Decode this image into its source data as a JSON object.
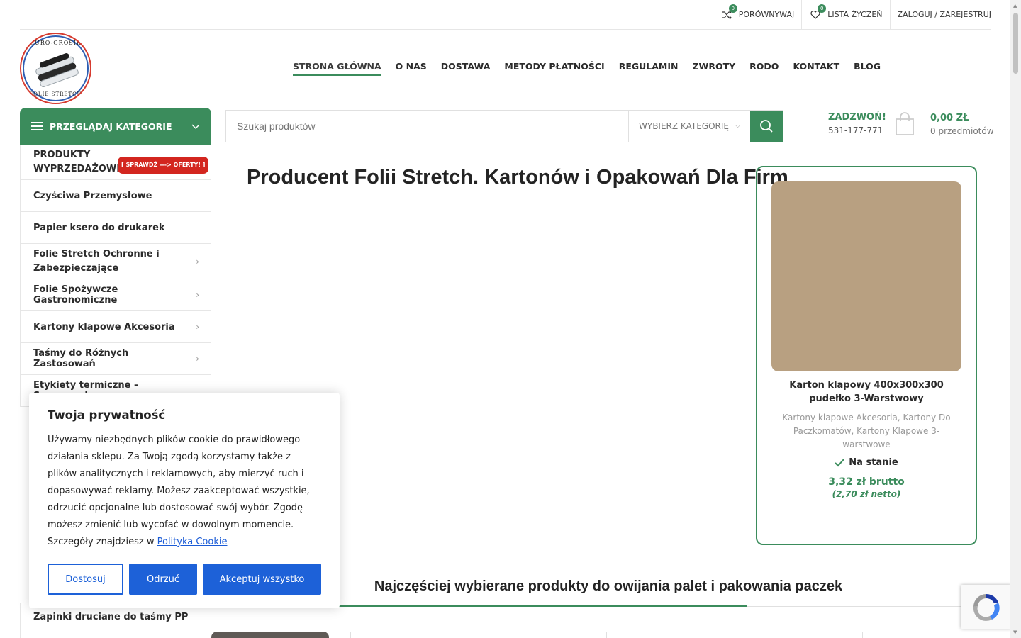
{
  "topbar": {
    "compare_label": "PORÓWNYWAJ",
    "compare_count": "0",
    "wishlist_label": "LISTA ŻYCZEŃ",
    "wishlist_count": "0",
    "login_label": "ZALOGUJ / ZAREJESTRUJ"
  },
  "logo": {
    "top_text": "EURO-GROSIK",
    "bottom_text": "FOLIE STRETCH"
  },
  "nav": {
    "items": [
      {
        "label": "STRONA GŁÓWNA"
      },
      {
        "label": "O NAS"
      },
      {
        "label": "DOSTAWA"
      },
      {
        "label": "METODY PŁATNOŚCI"
      },
      {
        "label": "REGULAMIN"
      },
      {
        "label": "ZWROTY"
      },
      {
        "label": "RODO"
      },
      {
        "label": "KONTAKT"
      },
      {
        "label": "BLOG"
      }
    ]
  },
  "categories": {
    "header": "PRZEGLĄDAJ KATEGORIE",
    "items": [
      {
        "label": "PRODUKTY WYPRZEDAŻOWE",
        "tag": "[ SPRAWDŹ ---> OFERTY! ]"
      },
      {
        "label": "Czyściwa Przemysłowe"
      },
      {
        "label": "Papier ksero do drukarek"
      },
      {
        "label": "Folie Stretch Ochronne i Zabezpieczające"
      },
      {
        "label": "Folie Spożywcze Gastronomiczne"
      },
      {
        "label": "Kartony klapowe Akcesoria"
      },
      {
        "label": "Taśmy do Różnych Zastosowań"
      },
      {
        "label": "Etykiety termiczne – Samoprzylepne"
      }
    ],
    "last_item": "Zapinki druciane do taśmy PP"
  },
  "search": {
    "placeholder": "Szukaj produktów",
    "category_select": "WYBIERZ KATEGORIĘ"
  },
  "contact": {
    "label": "ZADZWOŃ!",
    "phone": "531-177-771"
  },
  "cart": {
    "amount": "0,00 ZŁ",
    "items": "0 przedmiotów"
  },
  "main": {
    "title": "Producent Folii Stretch. Kartonów i Opakowań Dla Firm",
    "section_title": "Najczęściej wybierane produkty do owijania palet i pakowania paczek"
  },
  "product": {
    "title": "Karton klapowy 400x300x300 pudełko 3-Warstwowy",
    "categories": "Kartony klapowe Akcesoria, Kartony Do Paczkomatów, Kartony Klapowe 3-warstwowe",
    "stock": "Na stanie",
    "price": "3,32 zł brutto",
    "net": "(2,70 zł netto)"
  },
  "cookie": {
    "title": "Twoja prywatność",
    "body": "Używamy niezbędnych plików cookie do prawidłowego działania sklepu. Za Twoją zgodą korzystamy także z plików analitycznych i reklamowych, aby mierzyć ruch i dopasowywać reklamy. Możesz zaakceptować wszystkie, odrzucić opcjonalne lub dostosować swój wybór. Zgodę możesz zmienić lub wycofać w dowolnym momencie. Szczegóły znajdziesz w",
    "link": "Polityka Cookie",
    "btn_customize": "Dostosuj",
    "btn_reject": "Odrzuć",
    "btn_accept": "Akceptuj wszystko"
  },
  "colors": {
    "accent": "#3b8c5c",
    "cookie_blue": "#1d61d8",
    "promo_red": "#d3261f",
    "product_image": "#b8a081"
  }
}
